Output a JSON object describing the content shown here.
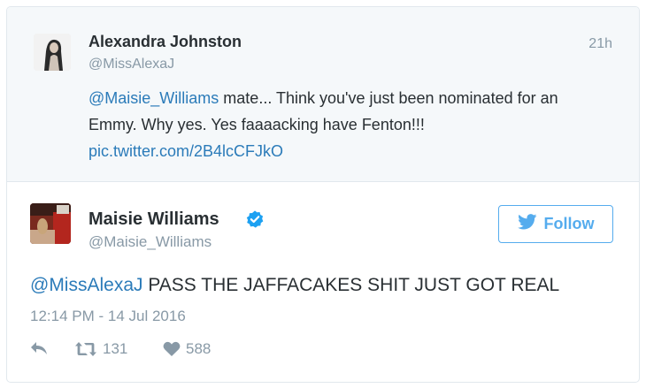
{
  "parent_tweet": {
    "author_name": "Alexandra Johnston",
    "author_handle": "@MissAlexaJ",
    "time": "21h",
    "text_mention": "@Maisie_Williams",
    "text_line1_rest": " mate... Think you've just been nominated for an",
    "text_line2": "Emmy. Why yes. Yes faaaacking have Fenton!!!",
    "text_link": "pic.twitter.com/2B4lcCFJkO"
  },
  "main_tweet": {
    "author_name": "Maisie Williams",
    "author_handle": "@Maisie_Williams",
    "follow_label": "Follow",
    "text_mention": "@MissAlexaJ",
    "text_body": " PASS THE JAFFACAKES SHIT JUST GOT REAL",
    "date": "12:14 PM - 14 Jul 2016",
    "retweet_count": "131",
    "like_count": "588"
  },
  "colors": {
    "link": "#2b7bb9",
    "twitter_blue": "#55acee",
    "muted": "#8899a6",
    "parent_bg": "#f5f8fa",
    "verified": "#1da1f2"
  },
  "icons": {
    "reply": "reply-icon",
    "retweet": "retweet-icon",
    "like": "heart-icon",
    "verified": "verified-badge-icon",
    "twitter": "twitter-bird-icon"
  }
}
